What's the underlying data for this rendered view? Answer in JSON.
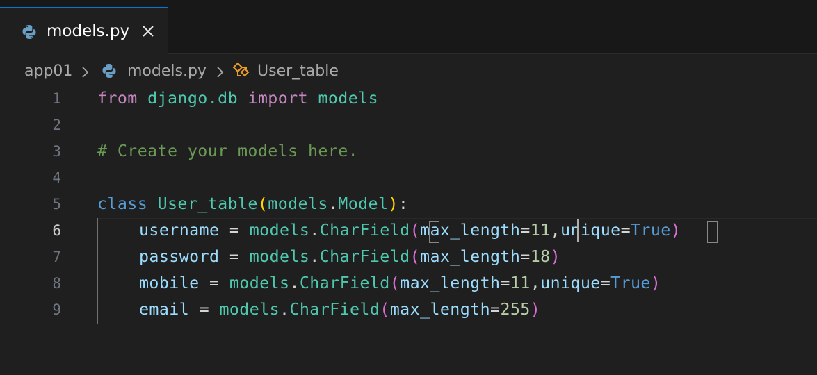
{
  "tab": {
    "label": "models.py",
    "close_glyph": "✕",
    "icon": "python-icon"
  },
  "breadcrumb": {
    "folder": "app01",
    "file": "models.py",
    "symbol": "User_table",
    "separator": "›"
  },
  "code": {
    "active_line": 6,
    "lines": [
      {
        "num": "1"
      },
      {
        "num": "2"
      },
      {
        "num": "3"
      },
      {
        "num": "4"
      },
      {
        "num": "5"
      },
      {
        "num": "6"
      },
      {
        "num": "7"
      },
      {
        "num": "8"
      },
      {
        "num": "9"
      }
    ],
    "l1": {
      "from": "from",
      "module": "django.db",
      "import": "import",
      "models": "models"
    },
    "l3": {
      "comment": "# Create your models here."
    },
    "l5": {
      "class": "class",
      "name": "User_table",
      "base_mod": "models",
      "base": "Model"
    },
    "l6": {
      "var": "username",
      "eq": "=",
      "mod": "models",
      "fn": "CharField",
      "kw1": "max_length",
      "v1": "11",
      "kw2": "unique",
      "v2": "True"
    },
    "l7": {
      "var": "password",
      "eq": "=",
      "mod": "models",
      "fn": "CharField",
      "kw1": "max_length",
      "v1": "18"
    },
    "l8": {
      "var": "mobile",
      "eq": "=",
      "mod": "models",
      "fn": "CharField",
      "kw1": "max_length",
      "v1": "11",
      "kw2": "unique",
      "v2": "True"
    },
    "l9": {
      "var": "email",
      "eq": "=",
      "mod": "models",
      "fn": "CharField",
      "kw1": "max_length",
      "v1": "255"
    }
  },
  "colors": {
    "accent": "#0078d4",
    "background": "#1f1f1f",
    "keyword": "#569cd6",
    "control_keyword": "#c586c0",
    "type": "#4ec9b0",
    "variable": "#9cdcfe",
    "number": "#b5cea8",
    "comment": "#6a9955",
    "bracket": "#ffd700"
  }
}
